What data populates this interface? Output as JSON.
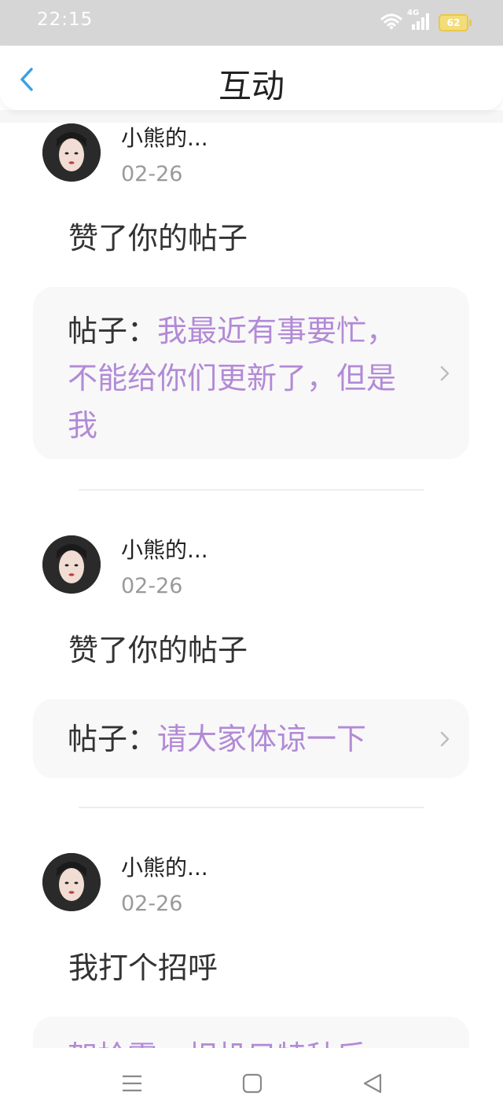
{
  "status_bar": {
    "time": "22:15",
    "network": "4G",
    "battery": "62"
  },
  "header": {
    "title": "互动"
  },
  "items": [
    {
      "username": "小熊的...",
      "date": "02-26",
      "action": "赞了你的帖子",
      "card_prefix": "帖子：",
      "card_text": "我最近有事要忙，不能给你们更新了，但是我"
    },
    {
      "username": "小熊的...",
      "date": "02-26",
      "action": "赞了你的帖子",
      "card_prefix": "帖子：",
      "card_text": "请大家体谅一下"
    },
    {
      "username": "小熊的...",
      "date": "02-26",
      "action": "我打个招呼",
      "card_prefix": "",
      "card_text": "架拾零，相机只特种后"
    }
  ],
  "colors": {
    "accent": "#3aa0e8",
    "link_purple": "#b28ad6",
    "card_bg": "#f8f8f8"
  },
  "nav_icons": [
    "menu-icon",
    "home-icon",
    "back-icon"
  ]
}
